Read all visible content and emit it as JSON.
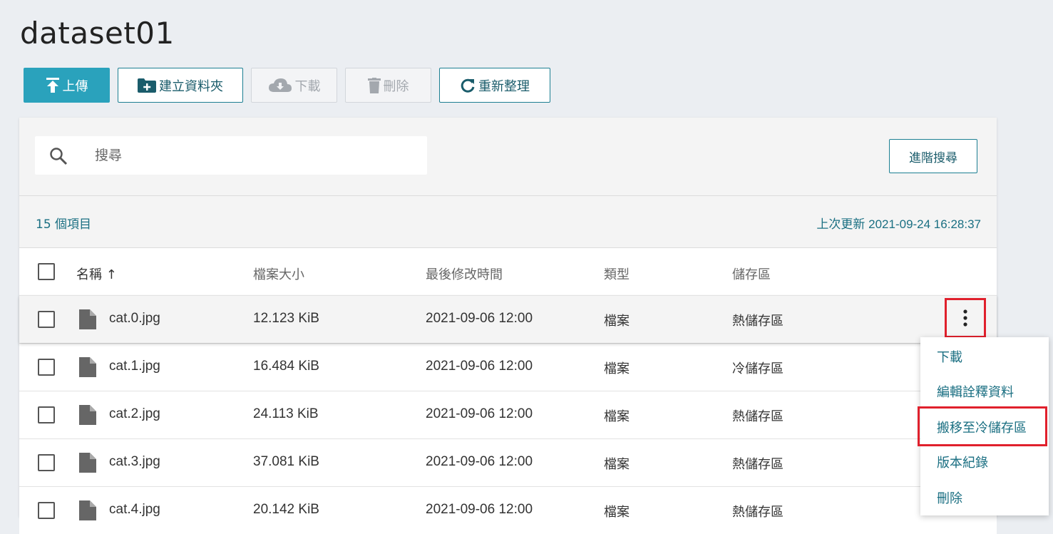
{
  "page": {
    "title": "dataset01"
  },
  "toolbar": {
    "upload": "上傳",
    "new_folder": "建立資料夾",
    "download": "下載",
    "delete": "刪除",
    "refresh": "重新整理"
  },
  "search": {
    "placeholder": "搜尋",
    "advanced": "進階搜尋"
  },
  "summary": {
    "count": "15 個項目",
    "updated": "上次更新 2021-09-24 16:28:37"
  },
  "table": {
    "columns": {
      "name": "名稱",
      "size": "檔案大小",
      "modified": "最後修改時間",
      "type": "類型",
      "storage": "儲存區"
    },
    "sort_indicator": "↑",
    "rows": [
      {
        "name": "cat.0.jpg",
        "size": "12.123 KiB",
        "modified": "2021-09-06 12:00",
        "type": "檔案",
        "storage": "熱儲存區"
      },
      {
        "name": "cat.1.jpg",
        "size": "16.484 KiB",
        "modified": "2021-09-06 12:00",
        "type": "檔案",
        "storage": "冷儲存區"
      },
      {
        "name": "cat.2.jpg",
        "size": "24.113 KiB",
        "modified": "2021-09-06 12:00",
        "type": "檔案",
        "storage": "熱儲存區"
      },
      {
        "name": "cat.3.jpg",
        "size": "37.081 KiB",
        "modified": "2021-09-06 12:00",
        "type": "檔案",
        "storage": "熱儲存區"
      },
      {
        "name": "cat.4.jpg",
        "size": "20.142 KiB",
        "modified": "2021-09-06 12:00",
        "type": "檔案",
        "storage": "熱儲存區"
      }
    ]
  },
  "context_menu": {
    "items": [
      "下載",
      "編輯詮釋資料",
      "搬移至冷儲存區",
      "版本紀錄",
      "刪除"
    ]
  },
  "colors": {
    "primary": "#2aa2bc",
    "accent_text": "#1a6f82",
    "highlight": "#e0202c"
  }
}
